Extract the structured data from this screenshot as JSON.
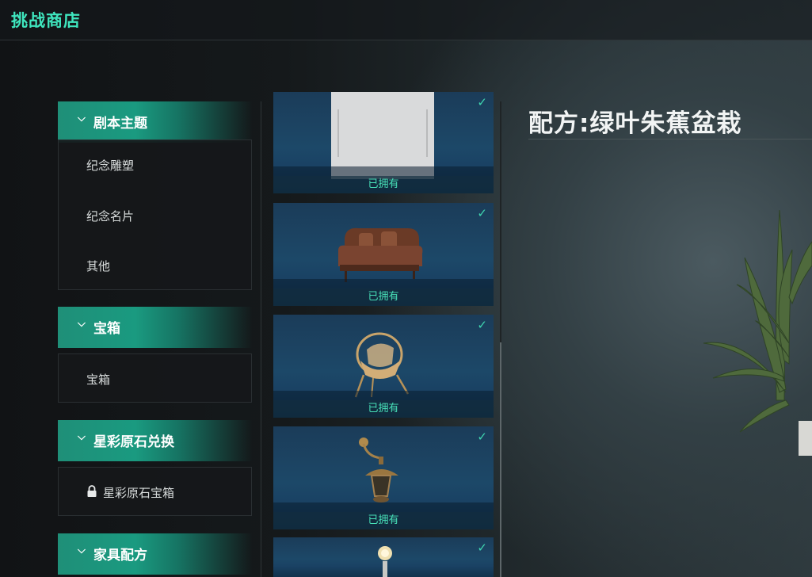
{
  "header": {
    "title": "挑战商店"
  },
  "sidebar": {
    "categories": [
      {
        "label": "剧本主题",
        "chevron": "chevron-down-icon",
        "items": [
          "纪念雕塑",
          "纪念名片",
          "其他"
        ]
      },
      {
        "label": "宝箱",
        "chevron": "chevron-down-icon",
        "items": [
          "宝箱"
        ]
      },
      {
        "label": "星彩原石兑换",
        "chevron": "chevron-down-icon",
        "items": [
          {
            "label": "星彩原石宝箱",
            "locked": true
          }
        ]
      },
      {
        "label": "家具配方",
        "chevron": "chevron-down-icon",
        "items": []
      }
    ]
  },
  "items_list": {
    "cards": [
      {
        "icon": "white-panel-icon",
        "status": "已拥有",
        "owned": true
      },
      {
        "icon": "leather-sofa-icon",
        "status": "已拥有",
        "owned": true
      },
      {
        "icon": "rattan-chair-icon",
        "status": "已拥有",
        "owned": true
      },
      {
        "icon": "wall-lantern-icon",
        "status": "已拥有",
        "owned": true
      },
      {
        "icon": "lamp-icon",
        "status": "",
        "owned": true
      }
    ],
    "check_symbol": "✓"
  },
  "detail": {
    "title": "配方:绿叶朱蕉盆栽",
    "preview_icon": "potted-plant-icon"
  },
  "colors": {
    "accent": "#3fe6be",
    "category_bg": "#1a9a80",
    "owned_text": "#48e0b8"
  }
}
